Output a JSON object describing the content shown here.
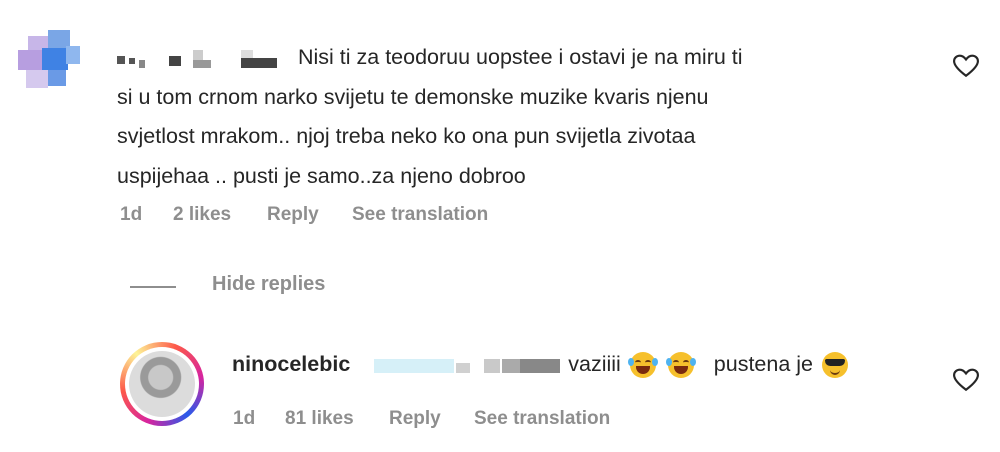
{
  "comment": {
    "text": "Nisi ti za teodoruu uopstee i ostavi je na miru ti si u tom crnom narko svijetu te demonske muzike kvaris njenu svjetlost mrakom.. njoj treba neko ko ona pun svijetla zivotaa uspijehaa .. pusti je samo..za njeno dobroo",
    "lines": [
      "Nisi ti za teodoruu uopstee i ostavi je na miru ti",
      "si u tom crnom narko svijetu te demonske muzike kvaris njenu",
      "svjetlost mrakom.. njoj treba neko ko ona pun svijetla zivotaa",
      "uspijehaa .. pusti je samo..za njeno dobroo"
    ],
    "time": "1d",
    "likes": "2 likes",
    "reply": "Reply",
    "see_translation": "See translation",
    "icons": {
      "avatar": "blurred-avatar",
      "like": "heart-icon"
    }
  },
  "thread": {
    "hide_replies": "Hide replies"
  },
  "reply_comment": {
    "username": "nino.celebic",
    "username_display": "ninocelebic",
    "text_a": "vaziiii",
    "text_b": "pustena je",
    "emojis": [
      "laughing-face-emoji",
      "laughing-face-emoji",
      "sunglasses-face-emoji"
    ],
    "time": "1d",
    "likes": "81 likes",
    "reply": "Reply",
    "see_translation": "See translation"
  },
  "colors": {
    "text": "#262626",
    "muted": "#8e8e8e",
    "ring": "#d6249f"
  }
}
